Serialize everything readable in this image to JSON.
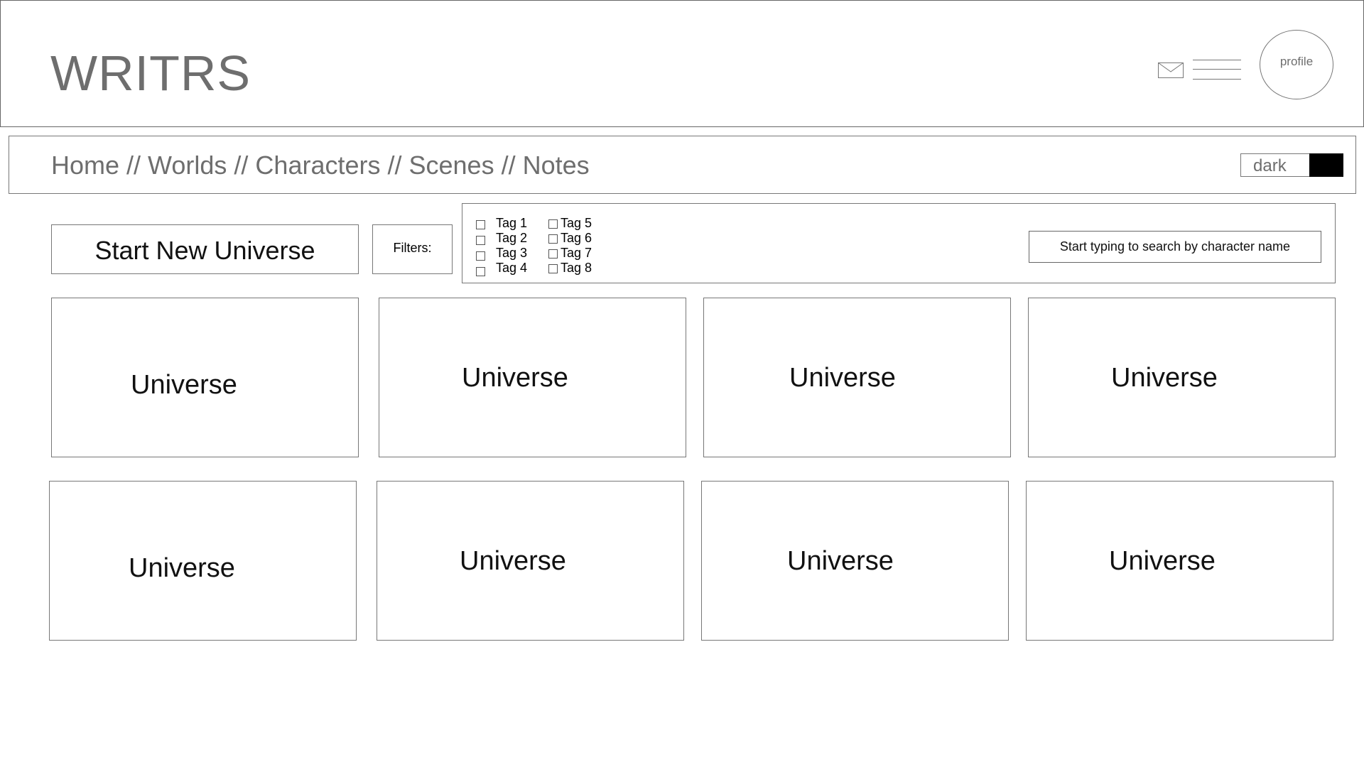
{
  "header": {
    "logo": "WRITRS",
    "mail_icon": "mail-icon",
    "menu_icon": "hamburger-menu-icon",
    "profile_label": "profile"
  },
  "nav": {
    "items": [
      {
        "label": "Home"
      },
      {
        "label": "Worlds"
      },
      {
        "label": "Characters"
      },
      {
        "label": "Scenes"
      },
      {
        "label": "Notes"
      }
    ],
    "separator": "//",
    "dark_toggle_label": "dark"
  },
  "controls": {
    "new_universe_label": "Start New Universe",
    "filters_label": "Filters:",
    "tags": [
      {
        "label": "Tag 1",
        "checked": false
      },
      {
        "label": "Tag 2",
        "checked": false
      },
      {
        "label": "Tag 3",
        "checked": false
      },
      {
        "label": "Tag 4",
        "checked": false
      },
      {
        "label": "Tag 5",
        "checked": false
      },
      {
        "label": "Tag 6",
        "checked": false
      },
      {
        "label": "Tag 7",
        "checked": false
      },
      {
        "label": "Tag 8",
        "checked": false
      }
    ],
    "search_placeholder": "Start typing to search by character name"
  },
  "universes": [
    {
      "label": "Universe"
    },
    {
      "label": "Universe"
    },
    {
      "label": "Universe"
    },
    {
      "label": "Universe"
    },
    {
      "label": "Universe"
    },
    {
      "label": "Universe"
    },
    {
      "label": "Universe"
    },
    {
      "label": "Universe"
    }
  ],
  "colors": {
    "logo_text": "#6e6e6e",
    "border": "#777777",
    "dark_knob": "#000000",
    "background": "#ffffff"
  }
}
